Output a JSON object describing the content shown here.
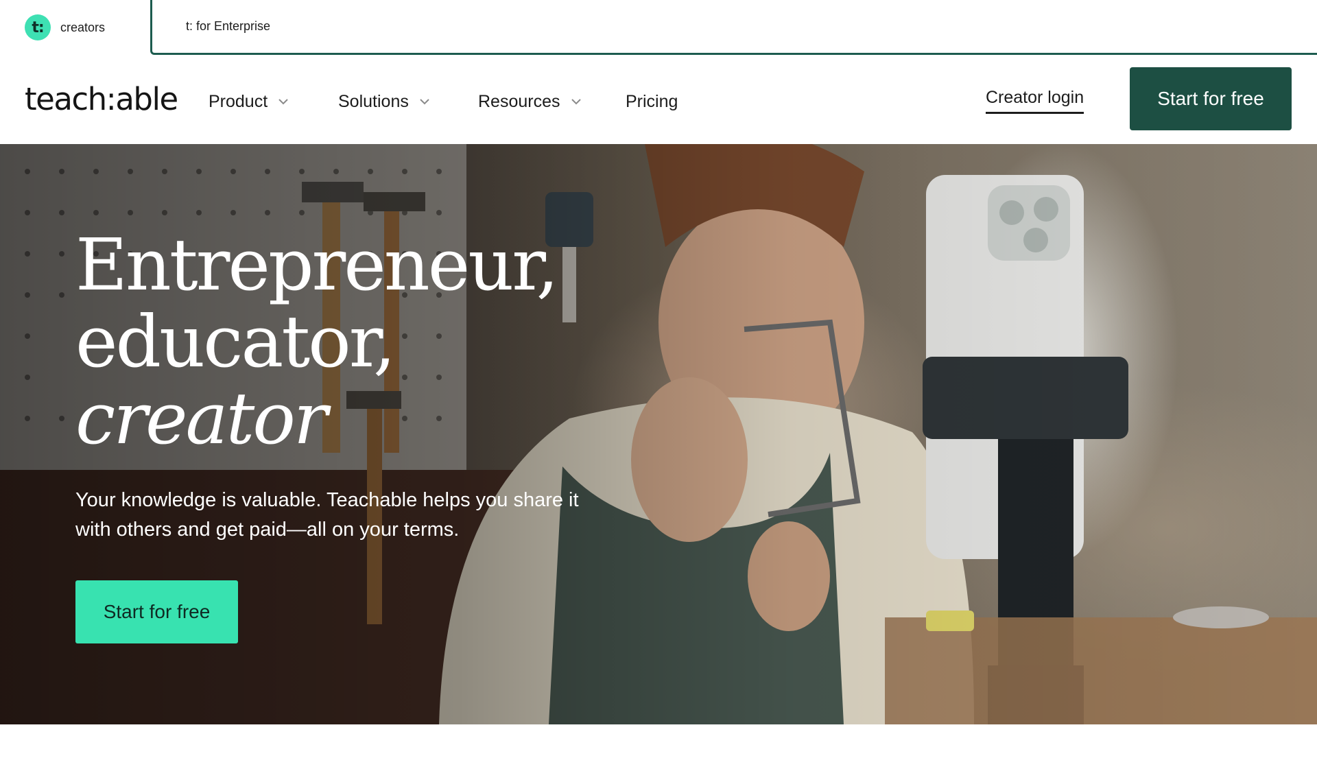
{
  "switcher": {
    "creators_logo": "t:",
    "creators_label": "creators",
    "enterprise_label": "t: for Enterprise"
  },
  "nav": {
    "brand": "teach:able",
    "items": [
      {
        "label": "Product",
        "has_dropdown": true
      },
      {
        "label": "Solutions",
        "has_dropdown": true
      },
      {
        "label": "Resources",
        "has_dropdown": true
      },
      {
        "label": "Pricing",
        "has_dropdown": false
      }
    ],
    "login_label": "Creator login",
    "cta_label": "Start for free",
    "icons": {
      "dropdown": "chevron-down-icon"
    }
  },
  "hero": {
    "headline_line1": "Entrepreneur,",
    "headline_line2": "educator,",
    "headline_line3": "creator",
    "subtext": "Your knowledge is valuable. Teachable helps you share it with others and get paid—all on your terms.",
    "cta_label": "Start for free"
  },
  "colors": {
    "brand_dark_green": "#1d4f43",
    "accent_mint": "#38e2b0",
    "switcher_border": "#1d5c4f"
  }
}
